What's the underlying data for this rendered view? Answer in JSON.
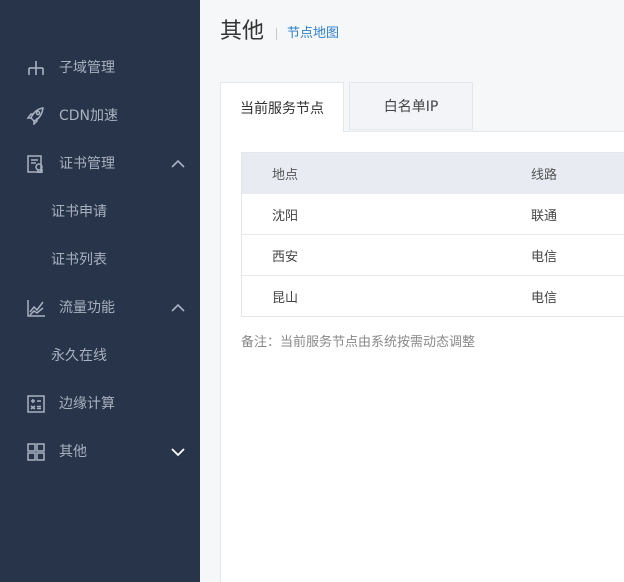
{
  "sidebar": {
    "items": [
      {
        "label": "子域管理",
        "icon": "sitemap-icon"
      },
      {
        "label": "CDN加速",
        "icon": "rocket-icon"
      },
      {
        "label": "证书管理",
        "icon": "certificate-icon",
        "expanded": true
      },
      {
        "label": "证书申请"
      },
      {
        "label": "证书列表"
      },
      {
        "label": "流量功能",
        "icon": "chart-icon",
        "expanded": true
      },
      {
        "label": "永久在线"
      },
      {
        "label": "边缘计算",
        "icon": "calculator-icon"
      },
      {
        "label": "其他",
        "icon": "grid-icon",
        "expanded": false
      }
    ]
  },
  "header": {
    "title": "其他",
    "breadcrumb": "节点地图"
  },
  "tabs": [
    {
      "label": "当前服务节点",
      "active": true
    },
    {
      "label": "白名单IP",
      "active": false
    }
  ],
  "table": {
    "columns": [
      "地点",
      "线路"
    ],
    "rows": [
      [
        "沈阳",
        "联通"
      ],
      [
        "西安",
        "电信"
      ],
      [
        "昆山",
        "电信"
      ]
    ]
  },
  "note": "备注：当前服务节点由系统按需动态调整",
  "colors": {
    "sidebar_bg": "#28344a",
    "link": "#2d7fd1",
    "table_header_bg": "#e8ebf1"
  }
}
